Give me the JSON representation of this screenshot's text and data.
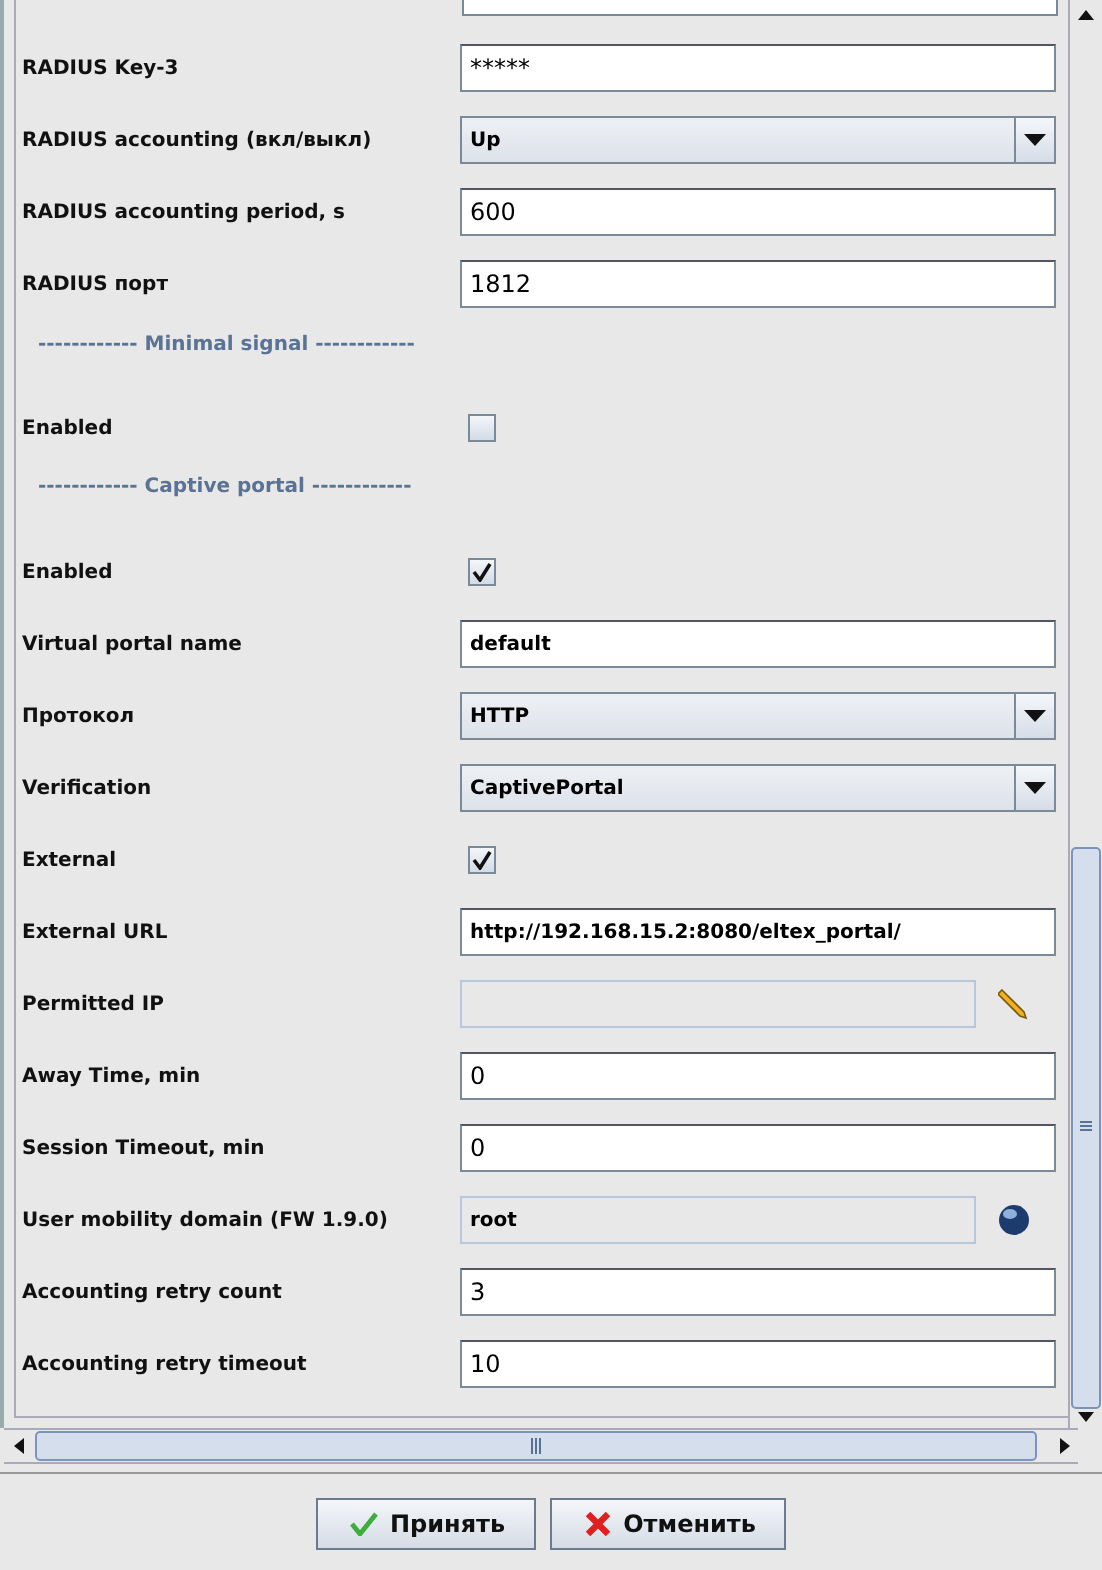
{
  "form": {
    "rows": [
      {
        "kind": "password",
        "label": "RADIUS Key-3",
        "value": "*****"
      },
      {
        "kind": "combo",
        "label": "RADIUS accounting (вкл/выкл)",
        "value": "Up"
      },
      {
        "kind": "number",
        "label": "RADIUS accounting period, s",
        "value": "600"
      },
      {
        "kind": "number",
        "label": "RADIUS порт",
        "value": "1812"
      },
      {
        "kind": "section",
        "label": "------------ Minimal signal ------------"
      },
      {
        "kind": "checkbox",
        "label": "Enabled",
        "checked": false
      },
      {
        "kind": "section",
        "label": "------------ Captive portal ------------"
      },
      {
        "kind": "checkbox",
        "label": "Enabled",
        "checked": true
      },
      {
        "kind": "text",
        "label": "Virtual portal name",
        "value": "default"
      },
      {
        "kind": "combo",
        "label": "Протокол",
        "value": "HTTP"
      },
      {
        "kind": "combo",
        "label": "Verification",
        "value": "CaptivePortal"
      },
      {
        "kind": "checkbox",
        "label": "External",
        "checked": true
      },
      {
        "kind": "text",
        "label": "External URL",
        "value": "http://192.168.15.2:8080/eltex_portal/"
      },
      {
        "kind": "edit-list",
        "label": "Permitted IP"
      },
      {
        "kind": "number",
        "label": "Away Time, min",
        "value": "0"
      },
      {
        "kind": "number",
        "label": "Session Timeout, min",
        "value": "0"
      },
      {
        "kind": "domain",
        "label": "User mobility domain (FW 1.9.0)",
        "value": "root"
      },
      {
        "kind": "number",
        "label": "Accounting retry count",
        "value": "3"
      },
      {
        "kind": "number",
        "label": "Accounting retry timeout",
        "value": "10"
      }
    ]
  },
  "buttons": [
    {
      "kind": "ok",
      "label": "Принять"
    },
    {
      "kind": "cancel",
      "label": "Отменить"
    }
  ]
}
